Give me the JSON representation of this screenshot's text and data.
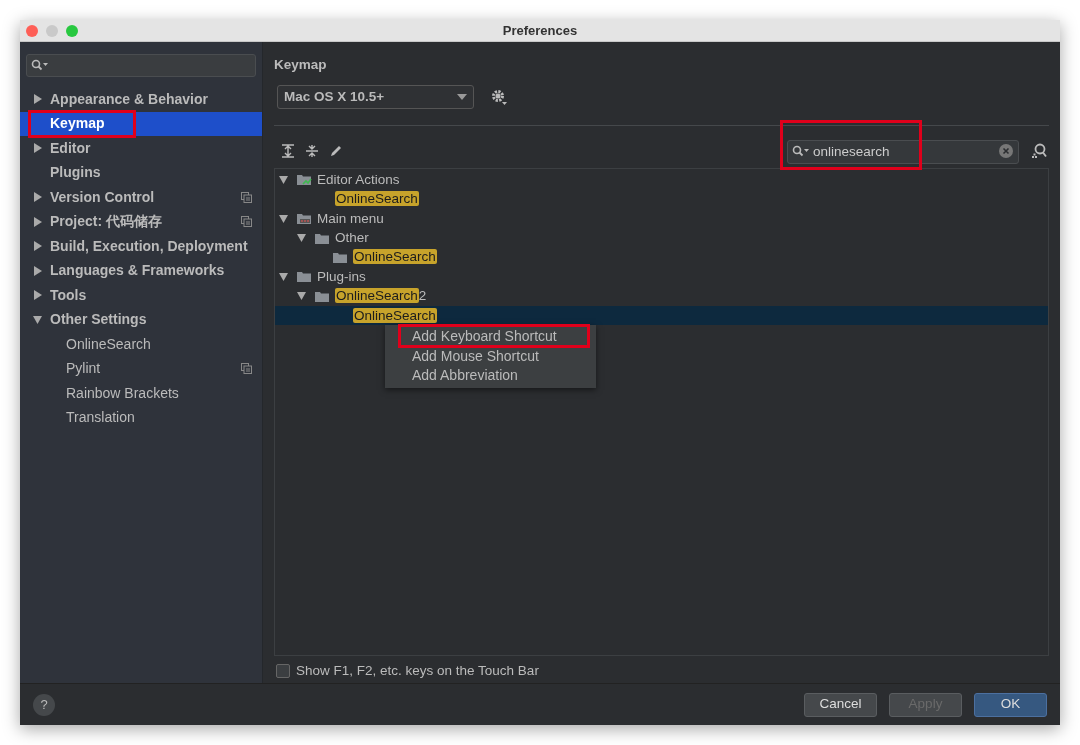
{
  "window": {
    "title": "Preferences"
  },
  "sidebar": {
    "items": [
      {
        "label": "Appearance & Behavior",
        "expandable": true,
        "expanded": false,
        "selected": false,
        "annotated": false,
        "badge_icon": false
      },
      {
        "label": "Keymap",
        "expandable": false,
        "selected": true,
        "annotated": true,
        "badge_icon": false
      },
      {
        "label": "Editor",
        "expandable": true,
        "expanded": false,
        "selected": false,
        "annotated": false,
        "badge_icon": false
      },
      {
        "label": "Plugins",
        "expandable": false,
        "selected": false,
        "annotated": false,
        "badge_icon": false
      },
      {
        "label": "Version Control",
        "expandable": true,
        "expanded": false,
        "selected": false,
        "annotated": false,
        "badge_icon": true
      },
      {
        "label": "Project: 代码储存",
        "expandable": true,
        "expanded": false,
        "selected": false,
        "annotated": false,
        "badge_icon": true
      },
      {
        "label": "Build, Execution, Deployment",
        "expandable": true,
        "expanded": false,
        "selected": false,
        "annotated": false,
        "badge_icon": false
      },
      {
        "label": "Languages & Frameworks",
        "expandable": true,
        "expanded": false,
        "selected": false,
        "annotated": false,
        "badge_icon": false
      },
      {
        "label": "Tools",
        "expandable": true,
        "expanded": false,
        "selected": false,
        "annotated": false,
        "badge_icon": false
      },
      {
        "label": "Other Settings",
        "expandable": true,
        "expanded": true,
        "selected": false,
        "annotated": false,
        "badge_icon": false,
        "children": [
          {
            "label": "OnlineSearch",
            "selected": false,
            "badge_icon": false
          },
          {
            "label": "Pylint",
            "selected": false,
            "badge_icon": true
          },
          {
            "label": "Rainbow Brackets",
            "selected": false,
            "badge_icon": false
          },
          {
            "label": "Translation",
            "selected": false,
            "badge_icon": false
          }
        ]
      }
    ]
  },
  "panel": {
    "title": "Keymap",
    "keymap_select": {
      "value": "Mac OS X 10.5+"
    },
    "search": {
      "value": "onlinesearch",
      "annotated": true
    },
    "tree": [
      {
        "label": "Editor Actions",
        "kind": "actions",
        "expanded": true,
        "selected": false,
        "children": [
          {
            "match": "OnlineSearch",
            "kind": "action",
            "selected": false
          }
        ]
      },
      {
        "label": "Main menu",
        "kind": "menu",
        "expanded": true,
        "selected": false,
        "children": [
          {
            "label": "Other",
            "kind": "folder",
            "expanded": true,
            "selected": false,
            "children": [
              {
                "match": "OnlineSearch",
                "kind": "folder",
                "selected": false
              }
            ]
          }
        ]
      },
      {
        "label": "Plug-ins",
        "kind": "folder",
        "expanded": true,
        "selected": false,
        "children": [
          {
            "match": "OnlineSearch",
            "rest": "2",
            "kind": "folder",
            "expanded": true,
            "selected": false,
            "children": [
              {
                "match": "OnlineSearch",
                "kind": "action",
                "selected": true
              }
            ]
          }
        ]
      }
    ],
    "context_menu": [
      {
        "label": "Add Keyboard Shortcut",
        "annotated": true
      },
      {
        "label": "Add Mouse Shortcut",
        "annotated": false
      },
      {
        "label": "Add Abbreviation",
        "annotated": false
      }
    ],
    "touch_bar_checkbox": {
      "label": "Show F1, F2, etc. keys on the Touch Bar",
      "checked": false
    }
  },
  "footer": {
    "help": "?",
    "buttons": [
      {
        "label": "Cancel",
        "kind": "normal",
        "disabled": false
      },
      {
        "label": "Apply",
        "kind": "normal",
        "disabled": true
      },
      {
        "label": "OK",
        "kind": "default",
        "disabled": false
      }
    ]
  }
}
